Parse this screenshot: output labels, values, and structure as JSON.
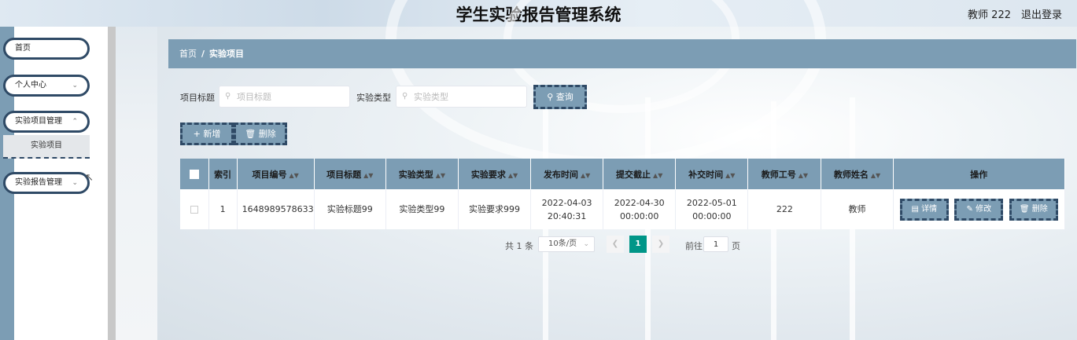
{
  "header": {
    "title": "学生实验报告管理系统",
    "user": "教师 222",
    "logout": "退出登录"
  },
  "sidebar": {
    "items": [
      {
        "label": "首页"
      },
      {
        "label": "个人中心"
      },
      {
        "label": "实验项目管理",
        "children": [
          {
            "label": "实验项目"
          }
        ]
      },
      {
        "label": "实验报告管理"
      }
    ]
  },
  "breadcrumb": {
    "home": "首页",
    "separator": "/",
    "current": "实验项目"
  },
  "search": {
    "title_label": "项目标题",
    "title_placeholder": "项目标题",
    "type_label": "实验类型",
    "type_placeholder": "实验类型",
    "query_button": "查询"
  },
  "actions": {
    "add_button": "新增",
    "delete_button": "删除"
  },
  "table": {
    "columns": [
      "索引",
      "项目编号",
      "项目标题",
      "实验类型",
      "实验要求",
      "发布时间",
      "提交截止",
      "补交时间",
      "教师工号",
      "教师姓名",
      "操作"
    ],
    "rows": [
      {
        "index": "1",
        "code": "1648989578633",
        "title": "实验标题99",
        "type": "实验类型99",
        "requirement": "实验要求999",
        "publish_time": "2022-04-03 20:40:31",
        "deadline": "2022-04-30 00:00:00",
        "late_time": "2022-05-01 00:00:00",
        "teacher_id": "222",
        "teacher_name": "教师"
      }
    ],
    "row_actions": {
      "detail": "详情",
      "edit": "修改",
      "delete": "删除"
    }
  },
  "pagination": {
    "total": "共 1 条",
    "page_size": "10条/页",
    "current_page": "1",
    "goto_label": "前往",
    "goto_value": "1",
    "page_unit": "页"
  },
  "colors": {
    "primary": "#7c9db4",
    "border_dashed": "#2f4a66",
    "active_page": "#009688"
  }
}
